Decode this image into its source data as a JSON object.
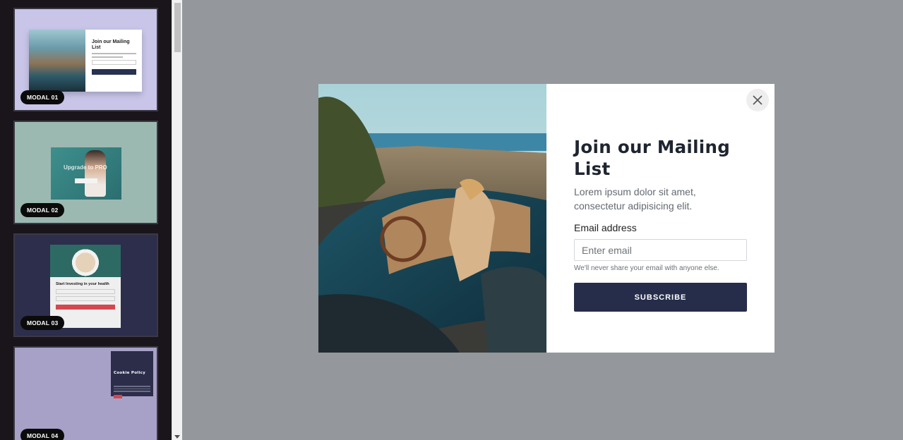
{
  "sidebar": {
    "items": [
      {
        "badge": "MODAL 01",
        "preview_title": "Join our Mailing List",
        "bg": "#c8c5e9"
      },
      {
        "badge": "MODAL 02",
        "preview_title": "Upgrade to PRO",
        "bg": "#9cb9b1"
      },
      {
        "badge": "MODAL 03",
        "preview_title": "Start Investing in your health",
        "bg": "#2d2d4c"
      },
      {
        "badge": "MODAL 04",
        "preview_title": "Cookie Policy",
        "bg": "#a7a1c7"
      }
    ]
  },
  "modal": {
    "image_icon": "convertible-car-photo",
    "close_icon": "close-icon",
    "title": "Join our Mailing List",
    "subtitle": "Lorem ipsum dolor sit amet, consectetur adipisicing elit.",
    "email_label": "Email address",
    "email_placeholder": "Enter email",
    "email_value": "",
    "help_text": "We'll never share your email with anyone else.",
    "subscribe_label": "SUBSCRIBE"
  },
  "colors": {
    "backdrop": "#94979b",
    "sidebar_bg": "#1a141b",
    "button_bg": "#252d4a",
    "accent_red": "#d4474f"
  }
}
